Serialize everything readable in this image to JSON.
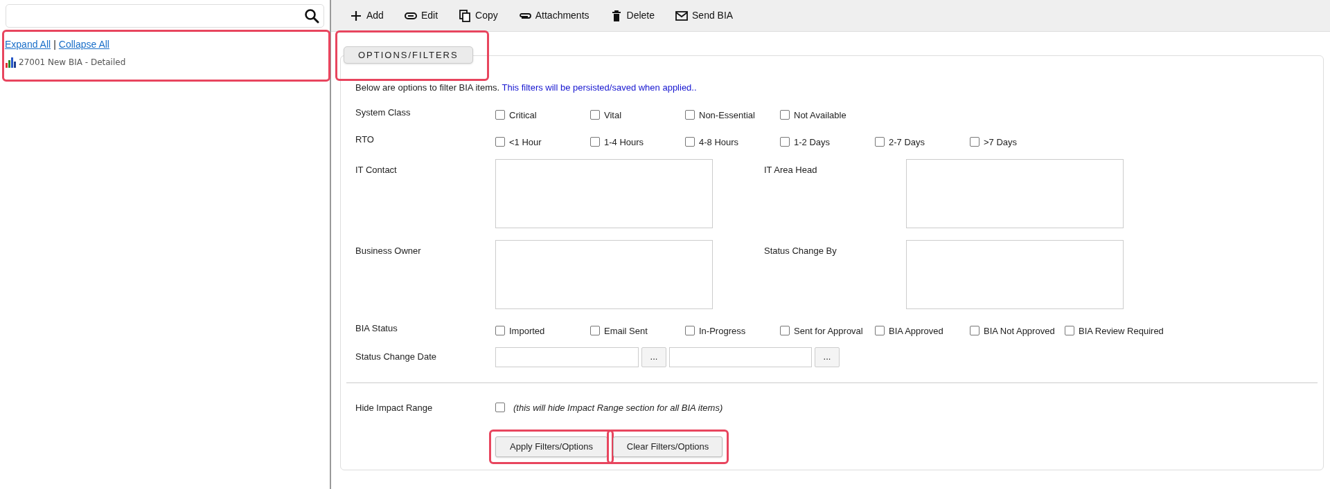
{
  "sidebar": {
    "expand_all": "Expand All",
    "separator": "|",
    "collapse_all": "Collapse All",
    "tree": [
      {
        "label": "27001 New BIA - Detailed"
      }
    ]
  },
  "toolbar": [
    {
      "label": "Add",
      "kind": "plus"
    },
    {
      "label": "Edit",
      "kind": "link"
    },
    {
      "label": "Copy",
      "kind": "copy"
    },
    {
      "label": "Attachments",
      "kind": "clip"
    },
    {
      "label": "Delete",
      "kind": "trash"
    },
    {
      "label": "Send BIA",
      "kind": "mail"
    }
  ],
  "panel": {
    "legend": "OPTIONS/FILTERS",
    "intro": "Below are options to filter BIA items.",
    "intro_note": "This filters will be persisted/saved when applied..",
    "rows": [
      {
        "kind": "checks",
        "label": "System Class",
        "options": [
          {
            "label": "Critical",
            "checked": false
          },
          {
            "label": "Vital",
            "checked": false
          },
          {
            "label": "Non-Essential",
            "checked": false
          },
          {
            "label": "Not Available",
            "checked": false
          }
        ]
      },
      {
        "kind": "checks",
        "label": "RTO",
        "options": [
          {
            "label": "<1 Hour",
            "checked": false
          },
          {
            "label": "1-4 Hours",
            "checked": false
          },
          {
            "label": "4-8 Hours",
            "checked": false
          },
          {
            "label": "1-2 Days",
            "checked": false
          },
          {
            "label": "2-7 Days",
            "checked": false
          },
          {
            "label": ">7 Days",
            "checked": false
          }
        ]
      },
      {
        "kind": "pickers",
        "label": "IT Contact",
        "label_2": "IT Area Head"
      },
      {
        "kind": "pickers",
        "label": "Business Owner",
        "label_2": "Status Change By"
      },
      {
        "kind": "checks",
        "label": "BIA Status",
        "options": [
          {
            "label": "Imported",
            "checked": false
          },
          {
            "label": "Email Sent",
            "checked": false
          },
          {
            "label": "In-Progress",
            "checked": false
          },
          {
            "label": "Sent for Approval",
            "checked": false
          },
          {
            "label": "BIA Approved",
            "checked": false
          },
          {
            "label": "BIA Not Approved",
            "checked": false
          },
          {
            "label": "BIA Review Required",
            "checked": false
          }
        ]
      },
      {
        "kind": "dates",
        "label": "Status Change Date",
        "button": "...",
        "button_2": "..."
      }
    ],
    "hide_impact": {
      "label": "Hide Impact Range",
      "checked": false,
      "note": "(this will hide Impact Range section for all BIA items)"
    },
    "buttons": [
      "Apply Filters/Options",
      "Clear Filters/Options"
    ]
  }
}
